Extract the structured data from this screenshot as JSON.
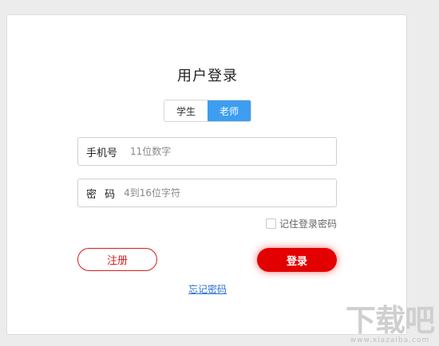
{
  "login": {
    "title": "用户登录",
    "roles": {
      "student": "学生",
      "teacher": "老师",
      "selected": "teacher"
    },
    "phone": {
      "label": "手机号",
      "placeholder": "11位数字",
      "value": ""
    },
    "password": {
      "label": "密 码",
      "placeholder": "4到16位字符",
      "value": ""
    },
    "remember_label": "记住登录密码",
    "register_label": "注册",
    "login_label": "登录",
    "forgot_label": "忘记密码"
  },
  "watermark": {
    "big": "下载吧",
    "small": "www.xiazaiba.com"
  },
  "colors": {
    "accent_red": "#e30000",
    "toggle_blue": "#3d9df0",
    "link_blue": "#2a6fd0"
  }
}
